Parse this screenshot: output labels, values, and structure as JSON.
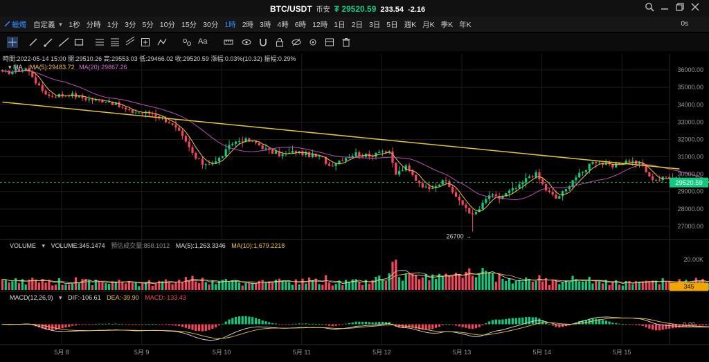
{
  "header": {
    "symbol": "BTC/USDT",
    "exchange": "币安",
    "price": "₮ 29520.59",
    "change": "233.54",
    "change_pct": "-2.16"
  },
  "timeframes": {
    "chart_type": "蠟燭",
    "custom": "自定義",
    "items": [
      "1秒",
      "分時",
      "1分",
      "3分",
      "5分",
      "10分",
      "15分",
      "30分",
      "1時",
      "2時",
      "3時",
      "4時",
      "6時",
      "12時",
      "1日",
      "2日",
      "3日",
      "5日",
      "週K",
      "月K",
      "季K",
      "年K"
    ],
    "active": "1時",
    "right_value": "0s"
  },
  "info": {
    "time": "時間:2022-05-14 15:00",
    "open": "開:29510.26",
    "high": "高:29553.03",
    "low": "低:29466.02",
    "close": "收:29520.59",
    "change": "漲幅:0.03%(10.32)",
    "amplitude": "振幅:0.29%"
  },
  "ma_legend": {
    "name": "MA",
    "ma5": "MA(5):29483.72",
    "ma20": "MA(20):29867.26"
  },
  "volume_legend": {
    "name": "VOLUME",
    "volume": "VOLUME:345.1474",
    "estimate": "預估成交量:858.1012",
    "ma5": "MA(5):1,263.3346",
    "ma10": "MA(10):1,679.2218"
  },
  "macd_legend": {
    "name": "MACD(12,26,9)",
    "dif": "DIF:-106.61",
    "dea": "DEA:-39.90",
    "macd": "MACD:-133.43"
  },
  "price_tag": "29520.59",
  "volume_tag": "345",
  "annotation_low": "26700 →",
  "colors": {
    "up": "#0ecb81",
    "down": "#f6465d",
    "ma5": "#f0c330",
    "ma20": "#c04fb6",
    "trend": "#e7c52a",
    "accent": "#2b8cff"
  },
  "chart_data": [
    {
      "type": "candlestick",
      "title": "BTC/USDT 1時",
      "ylim": [
        26400,
        36600
      ],
      "yticks": [
        "36000.00",
        "35000.00",
        "34000.00",
        "33000.00",
        "32000.00",
        "31000.00",
        "30000.00",
        "29000.00",
        "28000.00",
        "27000.00"
      ],
      "x_labels": [
        "5月 8",
        "5月 9",
        "5月 10",
        "5月 11",
        "5月 12",
        "5月 13",
        "5月 14",
        "5月 15"
      ],
      "x_label_day_index": [
        0,
        1,
        2,
        3,
        4,
        5,
        6,
        7
      ],
      "start_day_index": -0.74,
      "keypoints_close": [
        [
          0,
          35820
        ],
        [
          3,
          35900
        ],
        [
          7,
          36100
        ],
        [
          9,
          35650
        ],
        [
          11,
          35000
        ],
        [
          14,
          34500
        ],
        [
          20,
          34600
        ],
        [
          26,
          34300
        ],
        [
          32,
          34200
        ],
        [
          38,
          33600
        ],
        [
          45,
          33500
        ],
        [
          50,
          33000
        ],
        [
          53,
          32400
        ],
        [
          56,
          31500
        ],
        [
          58,
          30900
        ],
        [
          60,
          30600
        ],
        [
          64,
          30700
        ],
        [
          66,
          31100
        ],
        [
          69,
          31800
        ],
        [
          72,
          32000
        ],
        [
          76,
          31800
        ],
        [
          80,
          31300
        ],
        [
          84,
          31100
        ],
        [
          88,
          31300
        ],
        [
          92,
          31100
        ],
        [
          96,
          30900
        ],
        [
          98,
          30500
        ],
        [
          102,
          30900
        ],
        [
          106,
          31200
        ],
        [
          110,
          31000
        ],
        [
          113,
          31400
        ],
        [
          116,
          31200
        ],
        [
          118,
          30000
        ],
        [
          121,
          30400
        ],
        [
          124,
          29700
        ],
        [
          127,
          29200
        ],
        [
          130,
          29400
        ],
        [
          133,
          29600
        ],
        [
          135,
          29000
        ],
        [
          137,
          28400
        ],
        [
          139,
          28100
        ],
        [
          141,
          27600
        ],
        [
          143,
          28000
        ],
        [
          146,
          28800
        ],
        [
          149,
          28600
        ],
        [
          152,
          29000
        ],
        [
          155,
          29300
        ],
        [
          158,
          29900
        ],
        [
          160,
          30000
        ],
        [
          163,
          29100
        ],
        [
          166,
          28600
        ],
        [
          169,
          29100
        ],
        [
          171,
          29700
        ],
        [
          174,
          30100
        ],
        [
          177,
          30800
        ],
        [
          180,
          30600
        ],
        [
          183,
          30400
        ],
        [
          186,
          30700
        ],
        [
          188,
          30800
        ],
        [
          192,
          30500
        ],
        [
          194,
          29800
        ],
        [
          197,
          29700
        ],
        [
          200,
          29900
        ],
        [
          204,
          29600
        ],
        [
          207,
          29650
        ],
        [
          210,
          29500
        ],
        [
          213,
          29520
        ]
      ],
      "trend_line": {
        "from": [
          -0.74,
          34150
        ],
        "to": [
          7.72,
          30300
        ]
      },
      "last_close": 29520.59,
      "low_marker": 26700,
      "series": [
        {
          "name": "MA(5)"
        },
        {
          "name": "MA(20)"
        }
      ]
    },
    {
      "type": "bar",
      "title": "VOLUME",
      "ylim": [
        0,
        26000
      ],
      "yticks": [
        "20.00K"
      ],
      "last_value": 345,
      "series": [
        {
          "name": "MA(5)"
        },
        {
          "name": "MA(10)"
        }
      ]
    },
    {
      "type": "bar",
      "title": "MACD(12,26,9)",
      "ylim": [
        -1000,
        1000
      ],
      "yticks": [
        "0.00"
      ],
      "series": [
        {
          "name": "DIF"
        },
        {
          "name": "DEA"
        },
        {
          "name": "MACD"
        }
      ]
    }
  ]
}
